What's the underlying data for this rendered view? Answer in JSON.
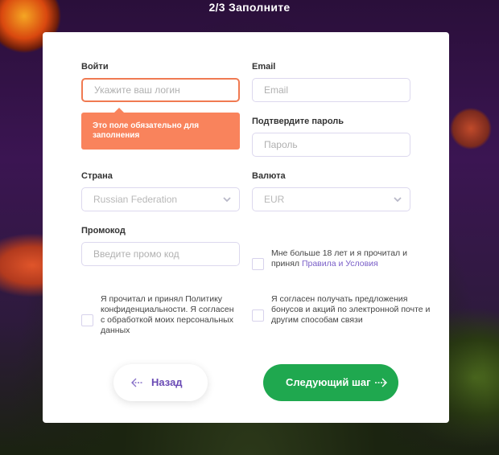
{
  "header": {
    "step_title": "2/3 Заполните"
  },
  "form": {
    "login": {
      "label": "Войти",
      "placeholder": "Укажите ваш логин"
    },
    "tooltip": {
      "text": "Это поле обязательно для заполнения"
    },
    "email": {
      "label": "Email",
      "placeholder": "Email"
    },
    "confirm_password": {
      "label": "Подтвердите пароль",
      "placeholder": "Пароль"
    },
    "country": {
      "label": "Страна",
      "value": "Russian Federation"
    },
    "currency": {
      "label": "Валюта",
      "value": "EUR"
    },
    "promo": {
      "label": "Промокод",
      "placeholder": "Введите промо код"
    },
    "age_consent": {
      "text": "Мне больше 18 лет и я прочитал и принял",
      "link": "Правила и Условия"
    },
    "privacy_consent": {
      "text": "Я прочитал и принял Политику конфиденциальности. Я согласен с обработкой моих персональных данных"
    },
    "bonus_consent": {
      "text": "Я согласен получать предложения бонусов и акций по электронной почте и другим способам связи"
    }
  },
  "buttons": {
    "back_label": "Назад",
    "next_label": "Следующий шаг"
  },
  "colors": {
    "primary": "#1fa84f",
    "accent": "#6a4bb5",
    "error": "#f9835c"
  }
}
